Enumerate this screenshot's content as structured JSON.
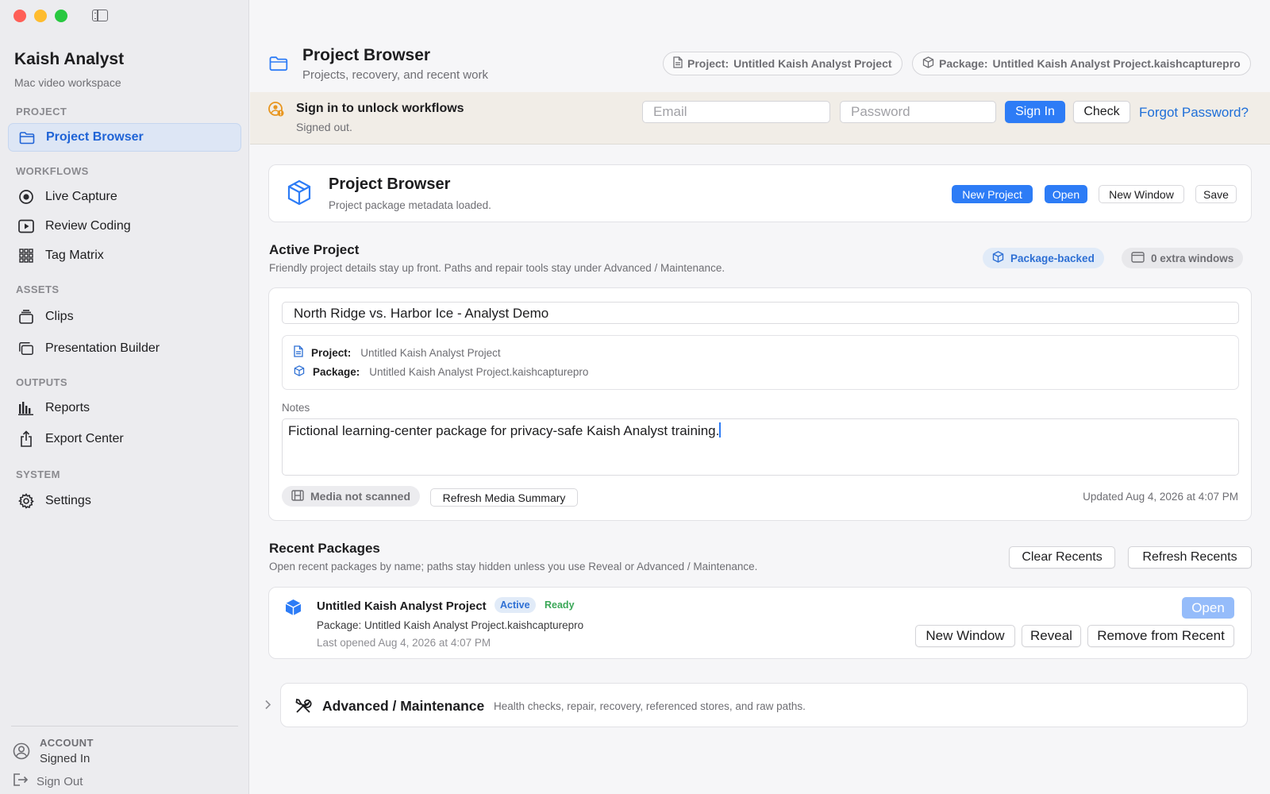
{
  "sidebar": {
    "app_title": "Kaish Analyst",
    "app_subtitle": "Mac video workspace",
    "sections": {
      "project": "PROJECT",
      "workflows": "WORKFLOWS",
      "assets": "ASSETS",
      "outputs": "OUTPUTS",
      "system": "SYSTEM"
    },
    "items": {
      "project_browser": "Project Browser",
      "live_capture": "Live Capture",
      "review_coding": "Review Coding",
      "tag_matrix": "Tag Matrix",
      "clips": "Clips",
      "presentation_builder": "Presentation Builder",
      "reports": "Reports",
      "export_center": "Export Center",
      "settings": "Settings"
    },
    "account_label": "ACCOUNT",
    "account_status": "Signed In",
    "sign_out": "Sign Out"
  },
  "header": {
    "title": "Project Browser",
    "subtitle": "Projects, recovery, and recent work",
    "project_key": "Project:",
    "project_value": "Untitled Kaish Analyst Project",
    "package_key": "Package:",
    "package_value": "Untitled Kaish Analyst Project.kaishcapturepro"
  },
  "signin": {
    "title": "Sign in to unlock workflows",
    "status": "Signed out.",
    "email_placeholder": "Email",
    "password_placeholder": "Password",
    "sign_in": "Sign In",
    "check": "Check",
    "forgot": "Forgot Password?"
  },
  "toolbar_card": {
    "title": "Project Browser",
    "subtitle": "Project package metadata loaded.",
    "new_project": "New Project",
    "open": "Open",
    "new_window": "New Window",
    "save": "Save"
  },
  "active_project": {
    "title": "Active Project",
    "subtitle": "Friendly project details stay up front. Paths and repair tools stay under Advanced / Maintenance.",
    "badge_package": "Package-backed",
    "badge_windows": "0 extra windows",
    "name": "North Ridge vs. Harbor Ice - Analyst Demo",
    "project_key": "Project:",
    "project_value": "Untitled Kaish Analyst Project",
    "package_key": "Package:",
    "package_value": "Untitled Kaish Analyst Project.kaishcapturepro",
    "notes_label": "Notes",
    "notes_value": "Fictional learning-center package for privacy-safe Kaish Analyst training.",
    "media_status": "Media not scanned",
    "refresh_media": "Refresh Media Summary",
    "updated": "Updated Aug 4, 2026 at 4:07 PM"
  },
  "recent": {
    "title": "Recent Packages",
    "subtitle": "Open recent packages by name; paths stay hidden unless you use Reveal or Advanced / Maintenance.",
    "clear": "Clear Recents",
    "refresh": "Refresh Recents",
    "items": [
      {
        "name": "Untitled Kaish Analyst Project",
        "badge_active": "Active",
        "badge_ready": "Ready",
        "package": "Package: Untitled Kaish Analyst Project.kaishcapturepro",
        "last_opened": "Last opened Aug 4, 2026 at 4:07 PM",
        "open": "Open",
        "new_window": "New Window",
        "reveal": "Reveal",
        "remove": "Remove from Recent"
      }
    ]
  },
  "advanced": {
    "title": "Advanced / Maintenance",
    "subtitle": "Health checks, repair, recovery, referenced stores, and raw paths."
  },
  "colors": {
    "accent": "#2d7cf6",
    "link": "#1f6fd8",
    "active_green": "#3aa757",
    "banner_bg": "#f1ede7"
  }
}
